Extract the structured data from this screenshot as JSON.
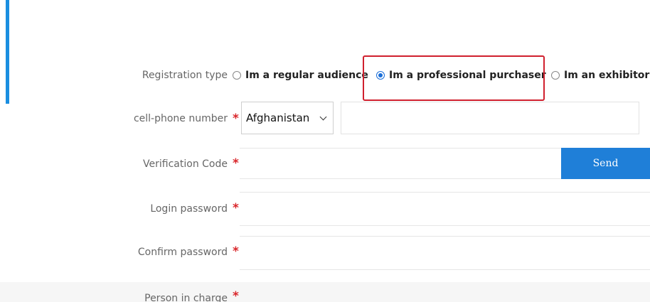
{
  "colors": {
    "accent": "#1a8ee0",
    "required": "#d9262b",
    "primary_button": "#1f7fd8",
    "highlight": "#d0202e"
  },
  "registration": {
    "label": "Registration type",
    "options": [
      {
        "label": "Im a regular audience",
        "checked": false
      },
      {
        "label": "Im a professional purchaser",
        "checked": true
      },
      {
        "label": "Im an exhibitor",
        "checked": false
      }
    ]
  },
  "phone": {
    "label": "cell-phone number",
    "required_mark": "*",
    "country": "Afghanistan"
  },
  "verification": {
    "label": "Verification Code",
    "required_mark": "*",
    "send_label": "Send"
  },
  "login_password": {
    "label": "Login password",
    "required_mark": "*"
  },
  "confirm_password": {
    "label": "Confirm password",
    "required_mark": "*"
  },
  "person_in_charge": {
    "label": "Person in charge",
    "required_mark": "*"
  }
}
